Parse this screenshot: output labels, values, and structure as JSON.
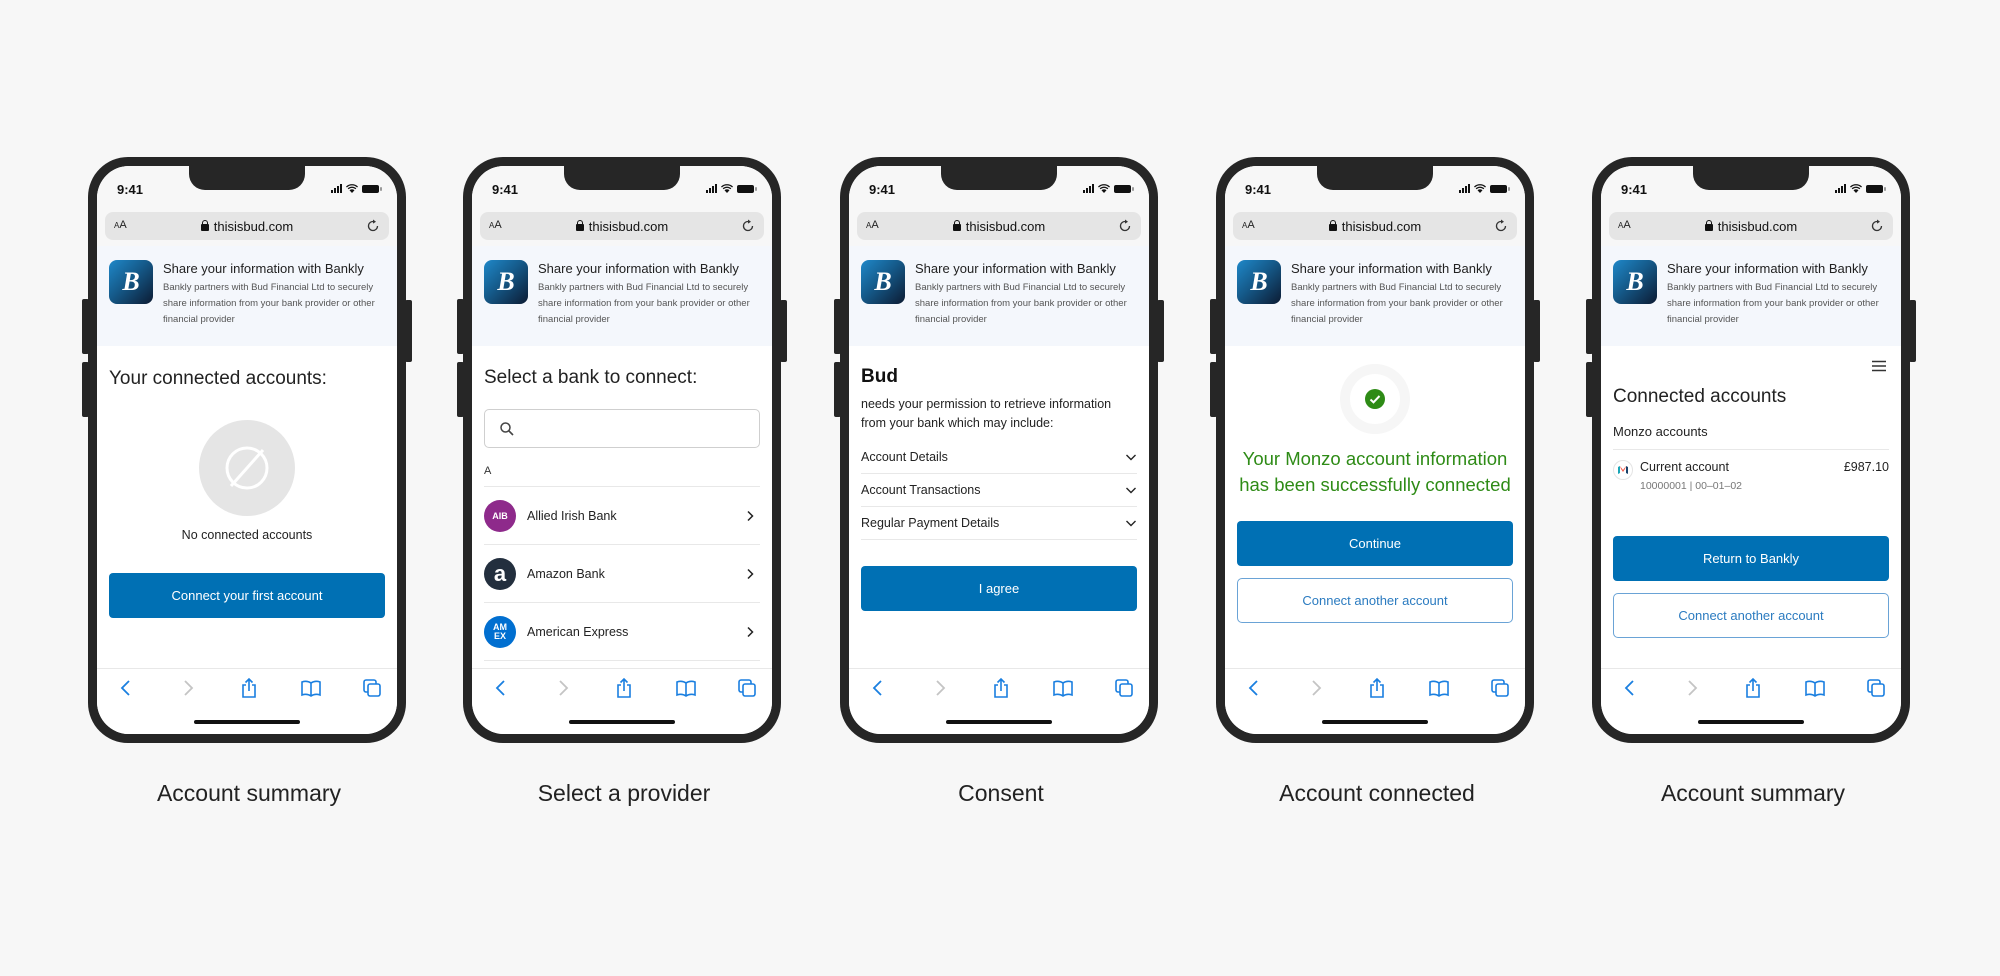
{
  "common": {
    "time": "9:41",
    "url": "thisisbud.com",
    "aa_small": "A",
    "aa_large": "A",
    "banner_title": "Share your information with Bankly",
    "banner_text": "Bankly partners with Bud Financial Ltd to securely share information from your bank provider or other financial provider",
    "logo_letter": "B",
    "toolbar_icons": [
      "back-icon",
      "forward-icon",
      "share-icon",
      "bookmarks-icon",
      "tabs-icon"
    ]
  },
  "screens": [
    {
      "caption": "Account summary",
      "heading": "Your connected accounts:",
      "empty_text": "No connected accounts",
      "primary_button": "Connect your first account"
    },
    {
      "caption": "Select a provider",
      "heading": "Select a bank to connect:",
      "search_placeholder": "",
      "section_letter": "A",
      "banks": [
        {
          "name": "Allied Irish Bank",
          "logo_text": "AIB",
          "color": "#8e2a8b"
        },
        {
          "name": "Amazon Bank",
          "logo_text": "a",
          "color": "#232f3e"
        },
        {
          "name": "American Express",
          "logo_text": "AM EX",
          "color": "#016fd0"
        }
      ]
    },
    {
      "caption": "Consent",
      "title": "Bud",
      "text": "needs your permission to retrieve information from your bank which may include:",
      "permissions": [
        "Account Details",
        "Account Transactions",
        "Regular Payment Details"
      ],
      "primary_button": "I agree"
    },
    {
      "caption": "Account connected",
      "message": "Your Monzo account information has been successfully connected",
      "primary_button": "Continue",
      "secondary_button": "Connect another account"
    },
    {
      "caption": "Account summary",
      "heading": "Connected accounts",
      "group_title": "Monzo accounts",
      "account": {
        "name": "Current account",
        "details": "10000001 | 00–01–02",
        "balance": "£987.10"
      },
      "primary_button": "Return to Bankly",
      "secondary_button": "Connect another account"
    }
  ],
  "colors": {
    "primary": "#0070b4",
    "success": "#2e8b16",
    "outline_text": "#2b7bc0"
  }
}
